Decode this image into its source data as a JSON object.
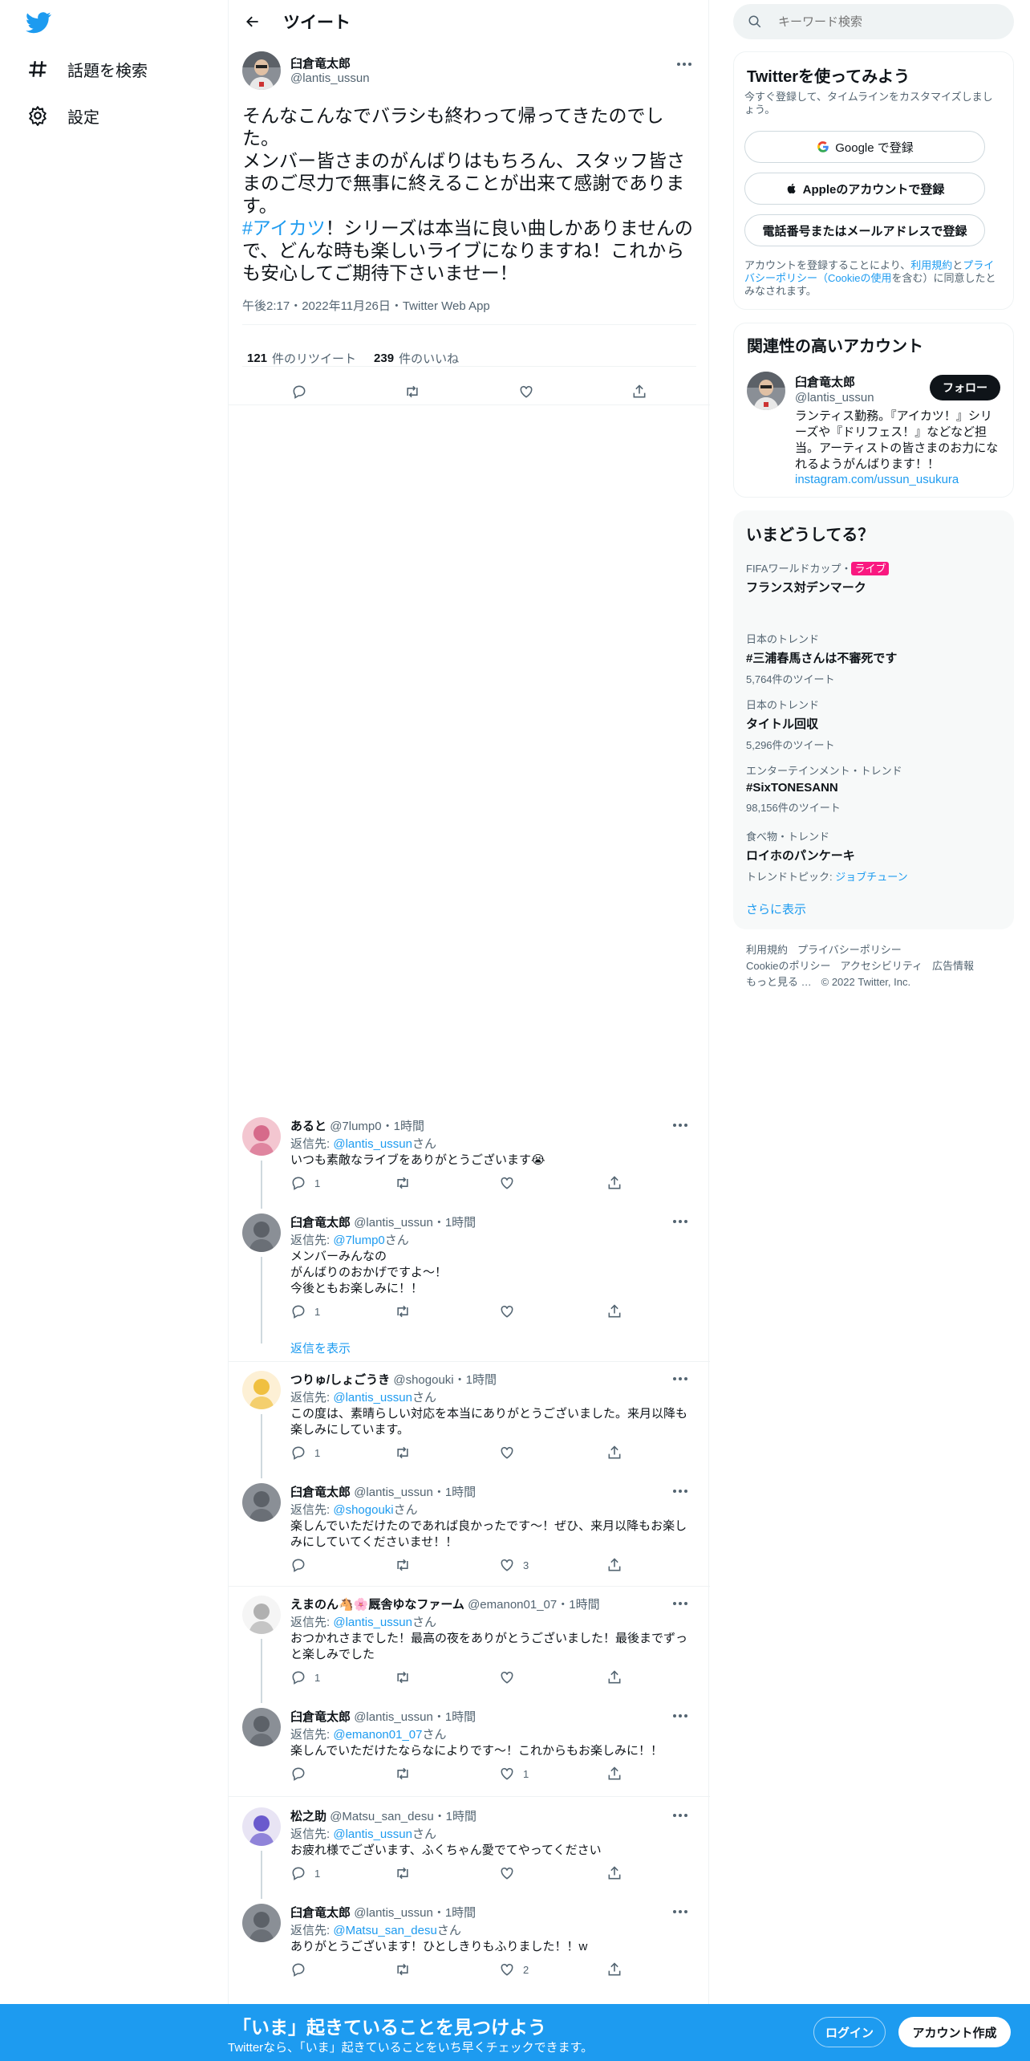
{
  "nav": {
    "logo": "twitter-bird-icon",
    "items": [
      {
        "label": "話題を検索",
        "icon": "hashtag-icon"
      },
      {
        "label": "設定",
        "icon": "gear-icon"
      }
    ]
  },
  "header": {
    "title": "ツイート"
  },
  "focal": {
    "name": "臼倉竜太郎",
    "handle": "@lantis_ussun",
    "text_before": "そんなこんなでバラシも終わって帰ってきたのでした。\nメンバー皆さまのがんばりはもちろん、スタッフ皆さまのご尽力で無事に終えることが出来て感謝であります。\n",
    "hashtag": "#アイカツ",
    "text_after": "！シリーズは本当に良い曲しかありませんので、どんな時も楽しいライブになりますね！これからも安心してご期待下さいませー！",
    "meta": "午後2:17・2022年11月26日・Twitter Web App",
    "retweets": "121",
    "retweets_label": "件のリツイート",
    "likes": "239",
    "likes_label": "件のいいね"
  },
  "reply_prefix": "返信先: ",
  "reply_suffix": "さん",
  "replies": [
    {
      "name": "あると",
      "handle": "@7lump0",
      "time": "・1時間",
      "to": "@lantis_ussun",
      "text": "いつも素敵なライブをありがとうございます😭",
      "replies": "1",
      "retweets": "",
      "likes": ""
    },
    {
      "name": "臼倉竜太郎",
      "handle": "@lantis_ussun",
      "time": "・1時間",
      "to": "@7lump0",
      "text": "メンバーみんなの\nがんばりのおかげですよ〜！\n今後ともお楽しみに！！",
      "replies": "1",
      "retweets": "",
      "likes": ""
    },
    {
      "name": "つりゅ/しょごうき",
      "handle": "@shogouki",
      "time": "・1時間",
      "to": "@lantis_ussun",
      "text": "この度は、素晴らしい対応を本当にありがとうございました。来月以降も楽しみにしています。",
      "replies": "1",
      "retweets": "",
      "likes": ""
    },
    {
      "name": "臼倉竜太郎",
      "handle": "@lantis_ussun",
      "time": "・1時間",
      "to": "@shogouki",
      "text": "楽しんでいただけたのであれば良かったです〜！ぜひ、来月以降もお楽しみにしていてくださいませ！！",
      "replies": "",
      "retweets": "",
      "likes": "3"
    },
    {
      "name": "えまのん🐴🌸厩舎ゆなファーム",
      "handle": "@emanon01_07",
      "time": "・1時間",
      "to": "@lantis_ussun",
      "text": "おつかれさまでした！最高の夜をありがとうございました！最後までずっと楽しみでした",
      "replies": "1",
      "retweets": "",
      "likes": ""
    },
    {
      "name": "臼倉竜太郎",
      "handle": "@lantis_ussun",
      "time": "・1時間",
      "to": "@emanon01_07",
      "text": "楽しんでいただけたならなによりです〜！これからもお楽しみに！！",
      "replies": "",
      "retweets": "",
      "likes": "1"
    },
    {
      "name": "松之助",
      "handle": "@Matsu_san_desu",
      "time": "・1時間",
      "to": "@lantis_ussun",
      "text": "お疲れ様でございます、ふくちゃん愛でてやってください",
      "replies": "1",
      "retweets": "",
      "likes": ""
    },
    {
      "name": "臼倉竜太郎",
      "handle": "@lantis_ussun",
      "time": "・1時間",
      "to": "@Matsu_san_desu",
      "text": "ありがとうございます！ひとしきりもふりました！！w",
      "replies": "",
      "retweets": "",
      "likes": "2"
    }
  ],
  "show_replies": "返信を表示",
  "search": {
    "placeholder": "キーワード検索"
  },
  "signup_card": {
    "title": "Twitterを使ってみよう",
    "subtitle": "今すぐ登録して、タイムラインをカスタマイズしましょう。",
    "google": "Google で登録",
    "apple": "Appleのアカウントで登録",
    "phone": "電話番号またはメールアドレスで登録",
    "terms_a": "アカウントを登録することにより、",
    "terms_link1": "利用規約",
    "terms_b": "と",
    "terms_link2": "プライバシーポリシー（Cookieの使用",
    "terms_c": "を含む）に同意したとみなされます。"
  },
  "related": {
    "title": "関連性の高いアカウント",
    "name": "臼倉竜太郎",
    "handle": "@lantis_ussun",
    "follow": "フォロー",
    "bio": "ランティス勤務。『アイカツ！』シリーズや『ドリフェス！』などなど担当。アーティストの皆さまのお力になれるようがんばります！！",
    "link": "instagram.com/ussun_usukura"
  },
  "trends": {
    "title": "いまどうしてる？",
    "items": [
      {
        "context": "FIFAワールドカップ・",
        "badge": "ライブ",
        "name": "フランス対デンマーク",
        "count": ""
      },
      {
        "context": "日本のトレンド",
        "badge": "",
        "name": "#三浦春馬さんは不審死です",
        "count": "5,764件のツイート"
      },
      {
        "context": "日本のトレンド",
        "badge": "",
        "name": "タイトル回収",
        "count": "5,296件のツイート"
      },
      {
        "context": "エンターテインメント・トレンド",
        "badge": "",
        "name": "#SixTONESANN",
        "count": "98,156件のツイート"
      },
      {
        "context": "食べ物・トレンド",
        "badge": "",
        "name": "ロイホのパンケーキ",
        "count": "トレンドトピック: ",
        "count_link": "ジョブチューン"
      }
    ],
    "more": "さらに表示"
  },
  "footer": {
    "links": [
      "利用規約",
      "プライバシーポリシー",
      "Cookieのポリシー",
      "アクセシビリティ",
      "広告情報",
      "もっと見る …",
      "© 2022 Twitter, Inc."
    ]
  },
  "bottom_bar": {
    "title": "「いま」起きていることを見つけよう",
    "subtitle": "Twitterなら、「いま」起きていることをいち早くチェックできます。",
    "login": "ログイン",
    "signup": "アカウント作成"
  },
  "colors": {
    "accent": "#1d9bf0",
    "live": "#f91880",
    "text": "#0f1419",
    "muted": "#536471"
  }
}
